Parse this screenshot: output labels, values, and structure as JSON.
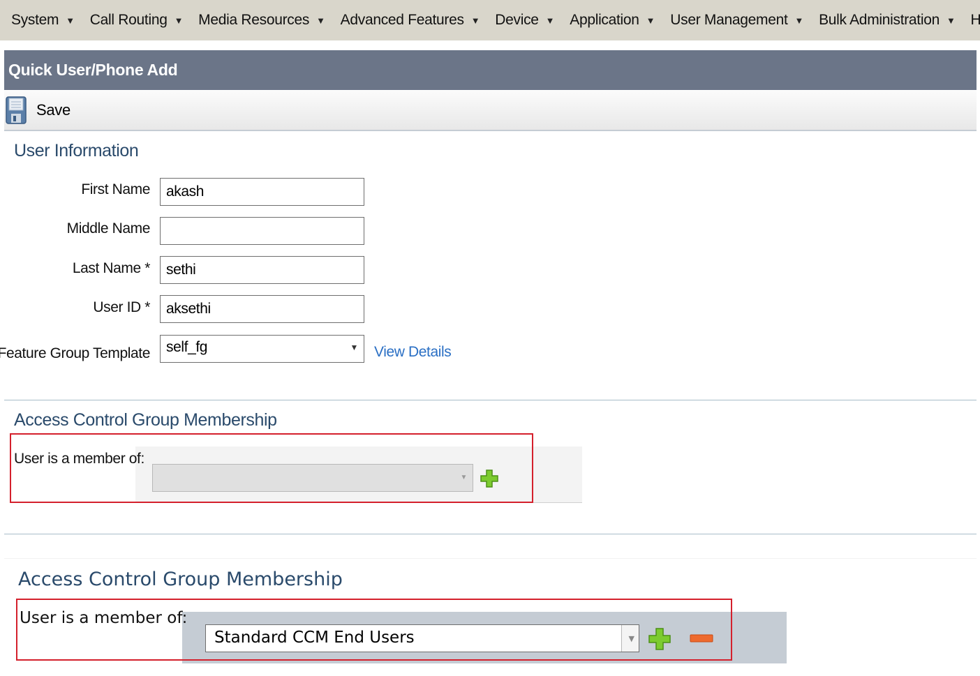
{
  "menubar": {
    "items": [
      {
        "label": "System"
      },
      {
        "label": "Call Routing"
      },
      {
        "label": "Media Resources"
      },
      {
        "label": "Advanced Features"
      },
      {
        "label": "Device"
      },
      {
        "label": "Application"
      },
      {
        "label": "User Management"
      },
      {
        "label": "Bulk Administration"
      },
      {
        "label": "Help"
      }
    ]
  },
  "page": {
    "title": "Quick User/Phone Add"
  },
  "toolbar": {
    "save_label": "Save"
  },
  "user_info": {
    "section_title": "User Information",
    "first_name_label": "First Name",
    "first_name_value": "akash",
    "middle_name_label": "Middle Name",
    "middle_name_value": "",
    "last_name_label": "Last Name *",
    "last_name_value": "sethi",
    "user_id_label": "User ID *",
    "user_id_value": "aksethi",
    "feature_group_label": "Feature Group Template",
    "feature_group_value": "self_fg",
    "view_details_label": "View Details"
  },
  "acg_before": {
    "section_title": "Access Control Group Membership",
    "member_label": "User is a member of:",
    "selected_value": ""
  },
  "acg_after": {
    "section_title": "Access Control Group Membership",
    "member_label": "User is a member of:",
    "selected_value": "Standard CCM End Users"
  },
  "colors": {
    "menubar_bg": "#d9d6cb",
    "titlebar_bg": "#6b7588",
    "highlight_border": "#d4202c",
    "link": "#2a6fc4",
    "plus_icon": "#6cbf2a",
    "minus_icon": "#e05a2a"
  }
}
